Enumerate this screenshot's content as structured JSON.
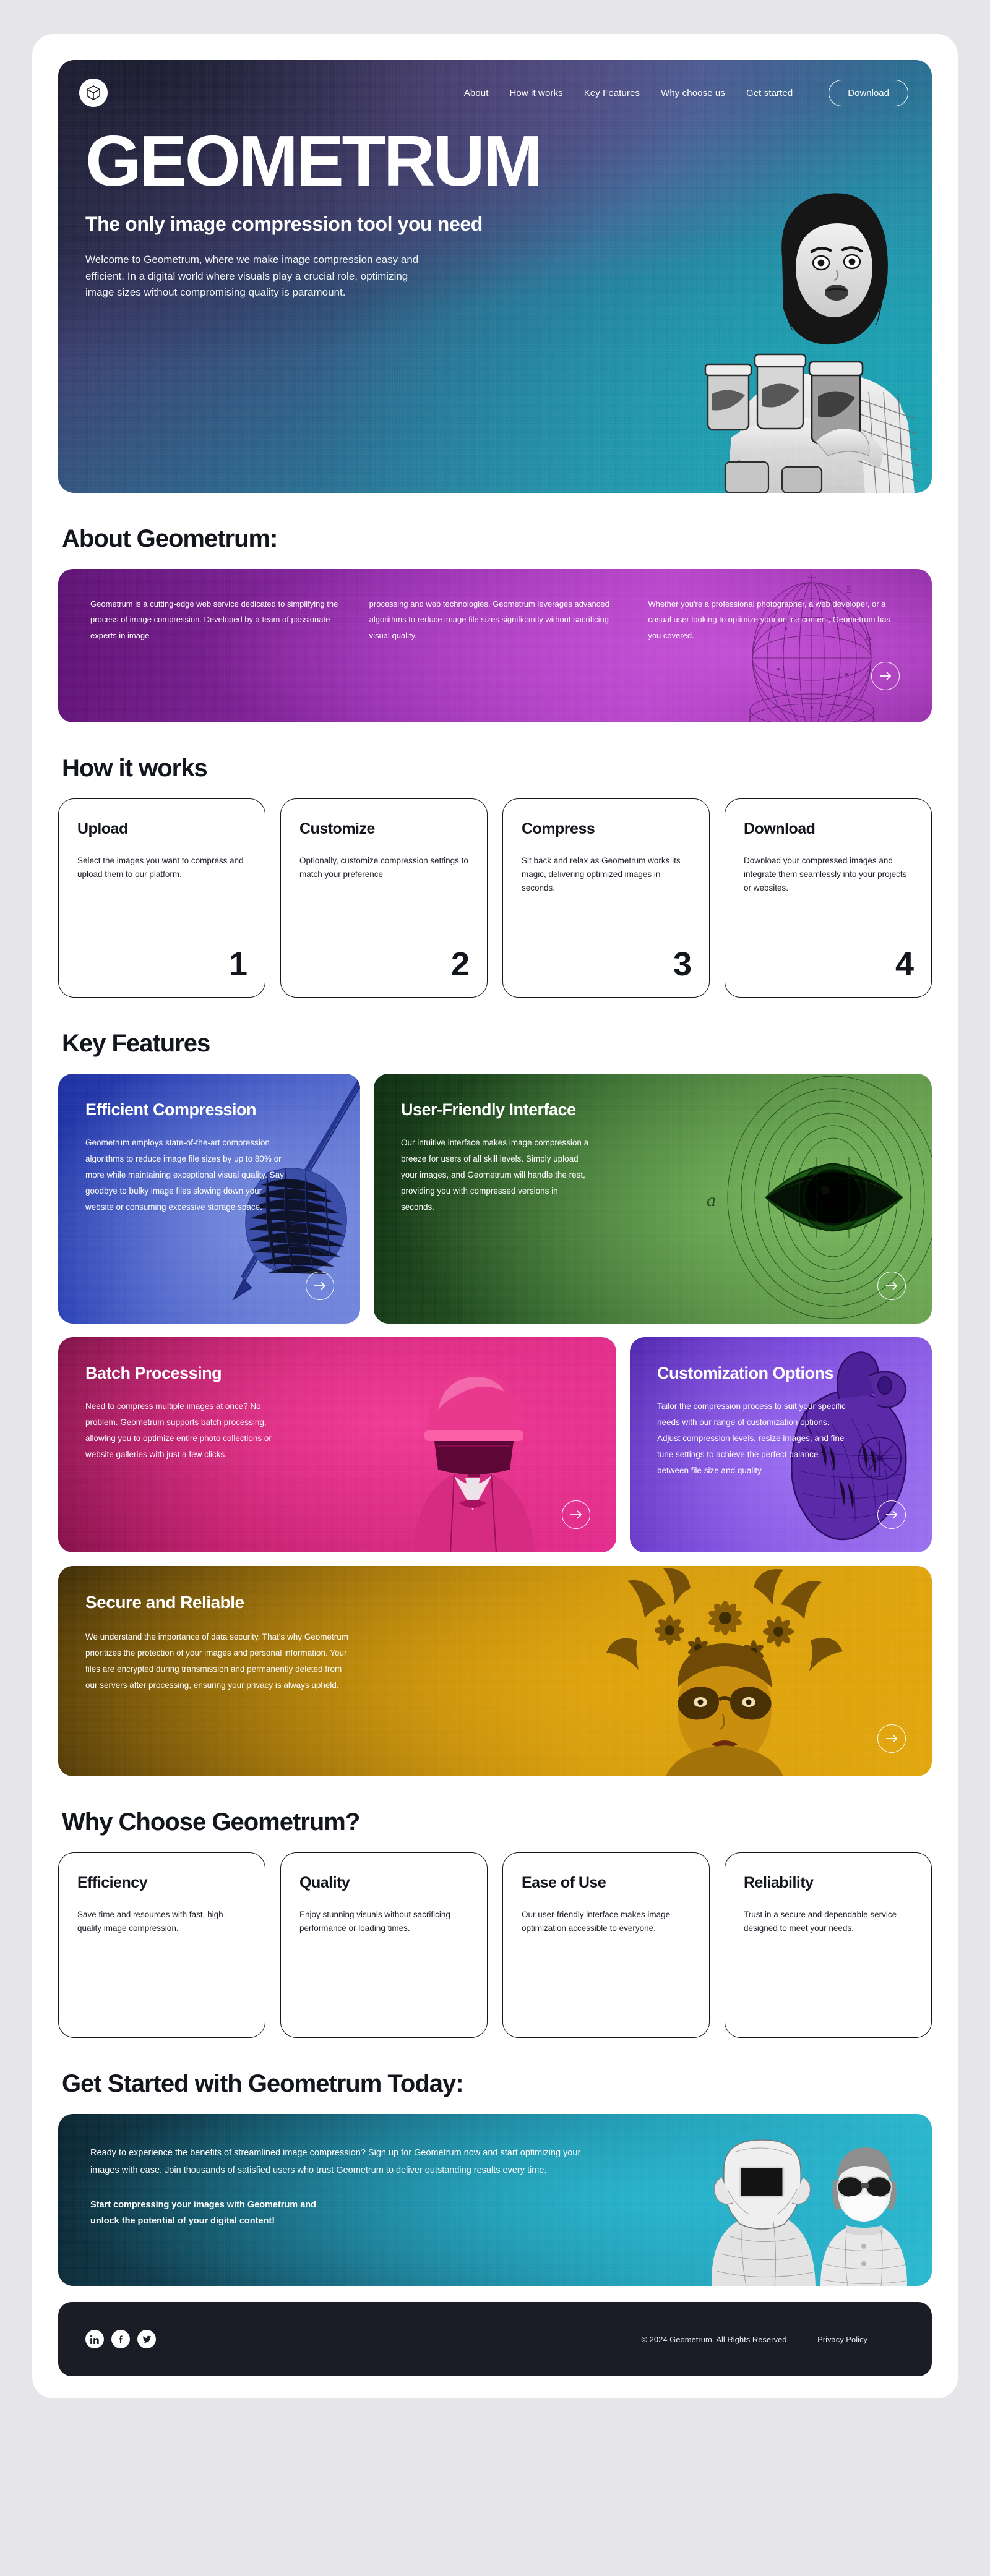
{
  "nav": {
    "logo_icon": "cube-logo-icon",
    "links": [
      {
        "label": "About"
      },
      {
        "label": "How it works"
      },
      {
        "label": "Key Features"
      },
      {
        "label": "Why choose us"
      },
      {
        "label": "Get started"
      }
    ],
    "download_label": "Download"
  },
  "hero": {
    "title": "GEOMETRUM",
    "subtitle": "The only image compression tool you need",
    "paragraph": "Welcome to Geometrum, where we make image compression easy and efficient. In a digital world where visuals play a crucial role, optimizing image sizes without compromising quality is paramount."
  },
  "about": {
    "heading": "About Geometrum:",
    "col1": "Geometrum is a cutting-edge web service dedicated to simplifying the process of image compression. Developed by a team of passionate experts in image",
    "col2": "processing and web technologies, Geometrum leverages advanced algorithms to reduce image file sizes significantly without sacrificing visual quality.",
    "col3": "Whether you're a professional photographer, a web developer, or a casual user looking to optimize your online content, Geometrum has you covered."
  },
  "how_it_works": {
    "heading": "How it works",
    "steps": [
      {
        "title": "Upload",
        "text": "Select the images you want to compress and upload them to our platform.",
        "num": "1"
      },
      {
        "title": "Customize",
        "text": "Optionally, customize compression settings to match your preference",
        "num": "2"
      },
      {
        "title": "Compress",
        "text": "Sit back and relax as Geometrum works its magic, delivering optimized images in seconds.",
        "num": "3"
      },
      {
        "title": "Download",
        "text": "Download your compressed images and integrate them seamlessly into your projects or websites.",
        "num": "4"
      }
    ]
  },
  "key_features": {
    "heading": "Key Features",
    "items": [
      {
        "title": "Efficient Compression",
        "text": "Geometrum employs state-of-the-art compression algorithms to reduce image file sizes by up to 80% or more while maintaining exceptional visual quality. Say goodbye to bulky image files slowing down your website or consuming excessive storage space.",
        "color": "#2f46b8"
      },
      {
        "title": "User-Friendly Interface",
        "text": "Our intuitive interface makes image compression a breeze for users of all skill levels. Simply upload your images, and Geometrum will handle the rest, providing you with compressed versions in seconds.",
        "color": "#2a5c27"
      },
      {
        "title": "Batch Processing",
        "text": "Need to compress multiple images at once? No problem. Geometrum supports batch processing, allowing you to optimize entire photo collections or website galleries with just a few clicks.",
        "color": "#b61664"
      },
      {
        "title": "Customization Options",
        "text": "Tailor the compression process to suit your specific needs with our range of customization options. Adjust compression levels, resize images, and fine-tune settings to achieve the perfect balance between file size and quality.",
        "color": "#6a35cf"
      },
      {
        "title": "Secure and Reliable",
        "text": "We understand the importance of data security. That's why Geometrum prioritizes the protection of your images and personal information. Your files are encrypted during transmission and permanently deleted from our servers after processing, ensuring your privacy is always upheld.",
        "color": "#c9920a"
      }
    ]
  },
  "why_choose": {
    "heading": "Why Choose Geometrum?",
    "cards": [
      {
        "title": "Efficiency",
        "text": "Save time and resources with fast, high-quality image compression."
      },
      {
        "title": "Quality",
        "text": "Enjoy stunning visuals without sacrificing performance or loading times."
      },
      {
        "title": "Ease of Use",
        "text": "Our user-friendly interface makes image optimization accessible to everyone."
      },
      {
        "title": "Reliability",
        "text": "Trust in a secure and dependable service designed to meet your needs."
      }
    ]
  },
  "cta": {
    "heading": "Get Started with Geometrum Today:",
    "paragraph": "Ready to experience the benefits of streamlined image compression? Sign up for Geometrum now and start optimizing your images with ease. Join thousands of satisfied users who trust Geometrum to deliver outstanding results every time.",
    "strong_line1": "Start compressing your images with Geometrum and",
    "strong_line2": "unlock the potential of your digital content!"
  },
  "footer": {
    "socials": [
      "linkedin-icon",
      "facebook-icon",
      "twitter-icon"
    ],
    "copyright": "© 2024 Geometrum. All Rights Reserved.",
    "privacy": "Privacy Policy"
  }
}
